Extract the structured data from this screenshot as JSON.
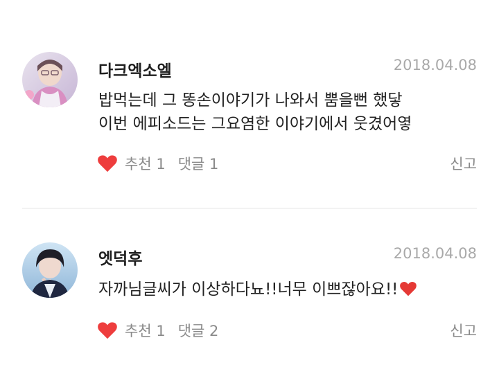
{
  "comments": [
    {
      "author": "다크엑소엘",
      "date": "2018.04.08",
      "lines": [
        "밥먹는데 그 똥손이야기가 나와서 뿜을뻔 했닿",
        "이번 에피소드는 그요염한 이야기에서 웃겼어옇"
      ],
      "recommend": "추천 1",
      "reply": "댓글 1",
      "report": "신고",
      "avatar_icon": "user-avatar-icon"
    },
    {
      "author": "엣덕후",
      "date": "2018.04.08",
      "lines": [
        "자까님글씨가 이상하다뇨!!너무 이쁘잖아요!!"
      ],
      "recommend": "추천 1",
      "reply": "댓글 2",
      "report": "신고",
      "avatar_icon": "user-avatar-icon"
    }
  ],
  "colors": {
    "heart": "#ee3d3d",
    "meta_text": "#a9a9a9",
    "action_text": "#8a8a8a",
    "divider": "#e4e4e4"
  }
}
